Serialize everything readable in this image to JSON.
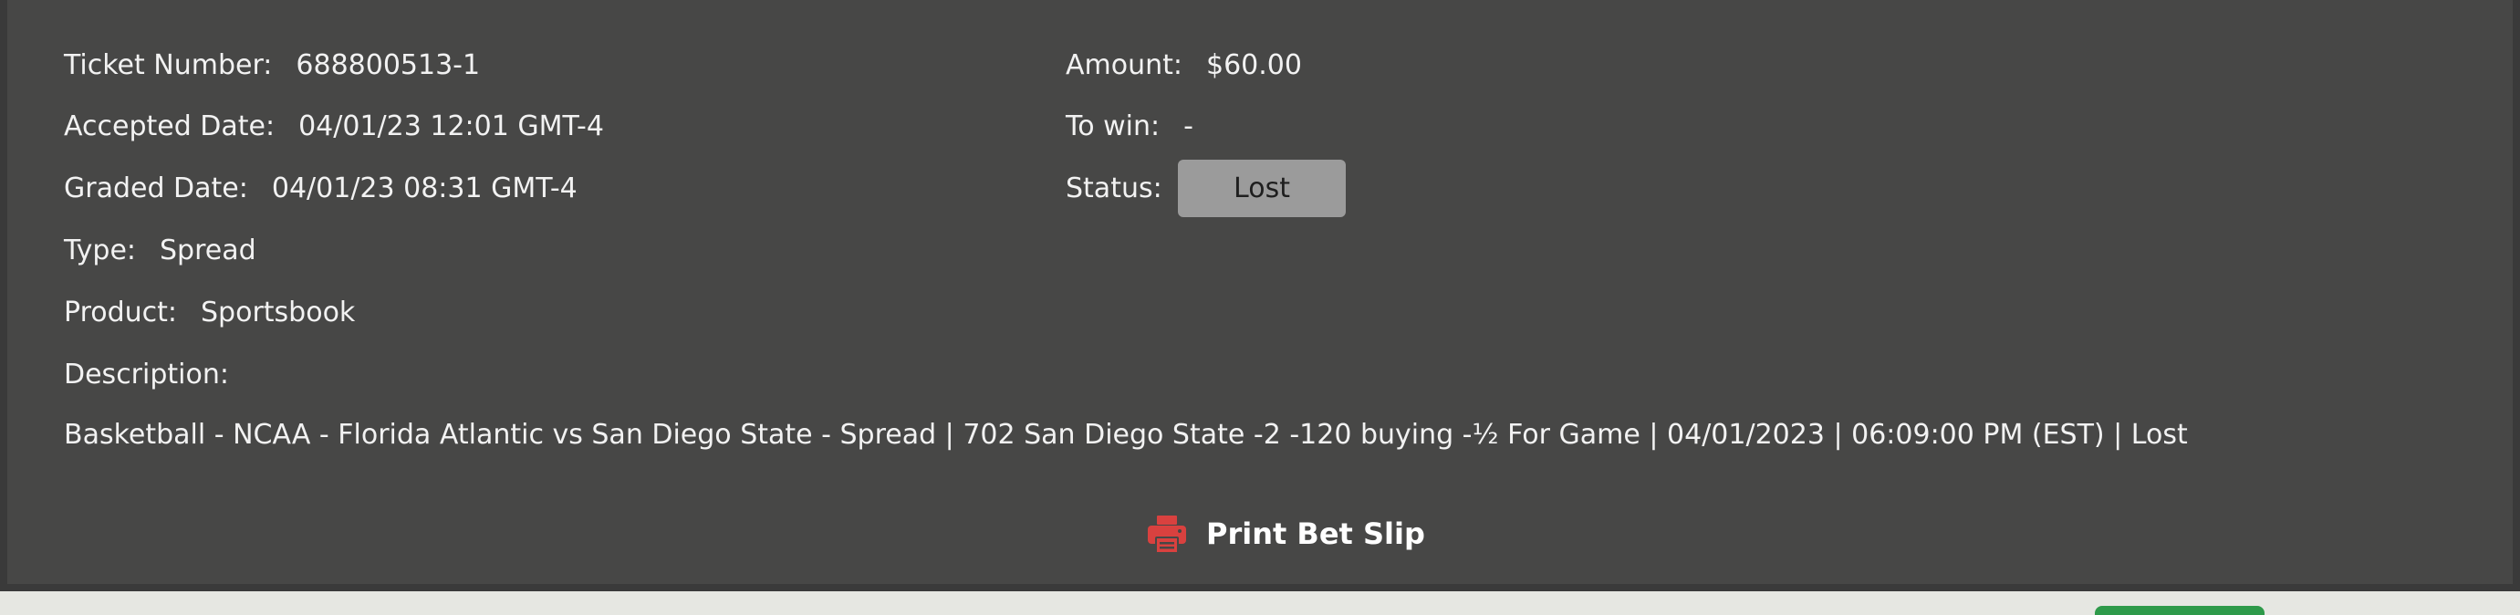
{
  "ticket": {
    "number_label": "Ticket Number:",
    "number_value": "688800513-1",
    "accepted_label": "Accepted Date:",
    "accepted_value": "04/01/23 12:01 GMT-4",
    "graded_label": "Graded Date:",
    "graded_value": "04/01/23 08:31 GMT-4",
    "type_label": "Type:",
    "type_value": "Spread",
    "product_label": "Product:",
    "product_value": "Sportsbook",
    "description_label": "Description:",
    "description_value": "Basketball - NCAA - Florida Atlantic vs San Diego State - Spread | 702 San Diego State -2 -120 buying -½ For Game | 04/01/2023 | 06:09:00 PM (EST) | Lost",
    "amount_label": "Amount:",
    "amount_value": "$60.00",
    "to_win_label": "To win:",
    "to_win_value": "-",
    "status_label": "Status:",
    "status_value": "Lost"
  },
  "actions": {
    "print_label": "Print Bet Slip",
    "print_icon": "printer-icon"
  },
  "colors": {
    "panel_bg": "#474746",
    "badge_bg": "#9b9b9b",
    "print_icon": "#d9413f",
    "accent_green": "#2e9a4a"
  }
}
